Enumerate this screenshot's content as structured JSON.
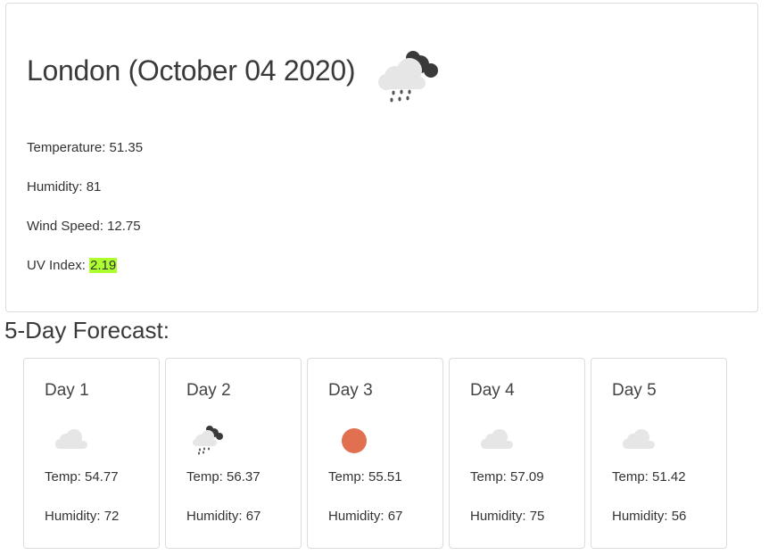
{
  "current": {
    "title": "London (October 04 2020)",
    "icon": "rain-cloud-icon",
    "temperature_label": "Temperature: ",
    "temperature": "51.35",
    "humidity_label": "Humidity: ",
    "humidity": "81",
    "wind_label": "Wind Speed: ",
    "wind": "12.75",
    "uv_label": "UV Index: ",
    "uv": "2.19",
    "uv_color": "#adff2f"
  },
  "forecast": {
    "title": "5-Day Forecast:",
    "temp_label": "Temp: ",
    "humidity_label": "Humidity: ",
    "days": [
      {
        "label": "Day 1",
        "icon": "cloud-icon",
        "temp": "54.77",
        "humidity": "72"
      },
      {
        "label": "Day 2",
        "icon": "rain-cloud-icon",
        "temp": "56.37",
        "humidity": "67"
      },
      {
        "label": "Day 3",
        "icon": "sun-icon",
        "temp": "55.51",
        "humidity": "67"
      },
      {
        "label": "Day 4",
        "icon": "cloud-icon",
        "temp": "57.09",
        "humidity": "75"
      },
      {
        "label": "Day 5",
        "icon": "cloud-icon",
        "temp": "51.42",
        "humidity": "56"
      }
    ]
  },
  "colors": {
    "sun": "#e07050",
    "cloud_light": "#e6e6e6",
    "cloud_dark": "#3a3a3a",
    "border": "#dcdcdc"
  }
}
